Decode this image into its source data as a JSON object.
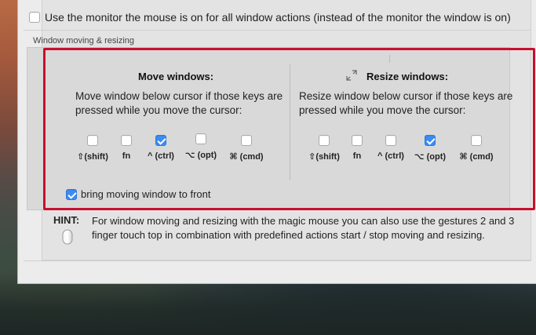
{
  "top_option": {
    "label": "Use the monitor the mouse is on for all window actions (instead of the monitor the window is on)",
    "checked": false
  },
  "section": {
    "title": "Window moving & resizing"
  },
  "move": {
    "title": "Move windows:",
    "description": "Move window below cursor if those keys are pressed while you move the cursor:",
    "keys": [
      {
        "label": "⇧(shift)",
        "checked": false
      },
      {
        "label": "fn",
        "checked": false
      },
      {
        "label": "^ (ctrl)",
        "checked": true
      },
      {
        "label": "⌥ (opt)",
        "checked": false
      },
      {
        "label": "⌘ (cmd)",
        "checked": false
      }
    ]
  },
  "resize": {
    "title": "Resize windows:",
    "icon": "resize-arrows-icon",
    "description": "Resize window below cursor if those keys are pressed while you move the cursor:",
    "keys": [
      {
        "label": "⇧(shift)",
        "checked": false
      },
      {
        "label": "fn",
        "checked": false
      },
      {
        "label": "^ (ctrl)",
        "checked": false
      },
      {
        "label": "⌥ (opt)",
        "checked": true
      },
      {
        "label": "⌘ (cmd)",
        "checked": false
      }
    ]
  },
  "bring_to_front": {
    "label": "bring moving window to front",
    "checked": true
  },
  "hint": {
    "label": "HINT:",
    "text": "For window moving and resizing with the magic mouse you can also use the gestures 2 and 3 finger touch top in combination with predefined actions start / stop moving and resizing.",
    "icon": "magic-mouse-icon"
  },
  "colors": {
    "accent": "#3b8cf4",
    "highlight": "#c8102e"
  }
}
